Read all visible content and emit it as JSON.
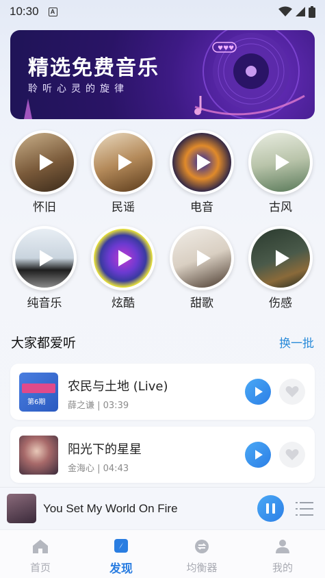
{
  "status": {
    "time": "10:30",
    "notif": "A"
  },
  "banner": {
    "title": "精选免费音乐",
    "subtitle": "聆听心灵的旋律"
  },
  "categories": [
    {
      "label": "怀旧",
      "color_a": "#7a5a3a",
      "color_b": "#c9b08a"
    },
    {
      "label": "民谣",
      "color_a": "#6b4a2a",
      "color_b": "#d9b98a"
    },
    {
      "label": "电音",
      "color_a": "#1a1a4a",
      "color_b": "#e08a2a"
    },
    {
      "label": "古风",
      "color_a": "#cfd6c4",
      "color_b": "#6b8a6a"
    },
    {
      "label": "纯音乐",
      "color_a": "#dfe6ee",
      "color_b": "#2a2a2a"
    },
    {
      "label": "炫酷",
      "color_a": "#e8e23a",
      "color_b": "#6a3ad0"
    },
    {
      "label": "甜歌",
      "color_a": "#e9e4dc",
      "color_b": "#6a5a4a"
    },
    {
      "label": "伤感",
      "color_a": "#3a4a3a",
      "color_b": "#7a5a3a"
    }
  ],
  "section": {
    "title": "大家都爱听",
    "action": "换一批"
  },
  "songs": [
    {
      "title": "农民与土地 (Live)",
      "meta": "薛之谦 | 03:39",
      "cover_color": "#3a6fd0",
      "cover_text": "第6期"
    },
    {
      "title": "阳光下的星星",
      "meta": "金海心 | 04:43",
      "cover_color": "#a86a6a",
      "cover_text": ""
    }
  ],
  "player": {
    "title": "You Set My World On Fire"
  },
  "tabs": [
    {
      "label": "首页",
      "icon": "home-icon"
    },
    {
      "label": "发现",
      "icon": "compass-icon"
    },
    {
      "label": "均衡器",
      "icon": "equalizer-icon"
    },
    {
      "label": "我的",
      "icon": "profile-icon"
    }
  ],
  "colors": {
    "accent": "#2a7de1",
    "link": "#2a8bd9"
  }
}
